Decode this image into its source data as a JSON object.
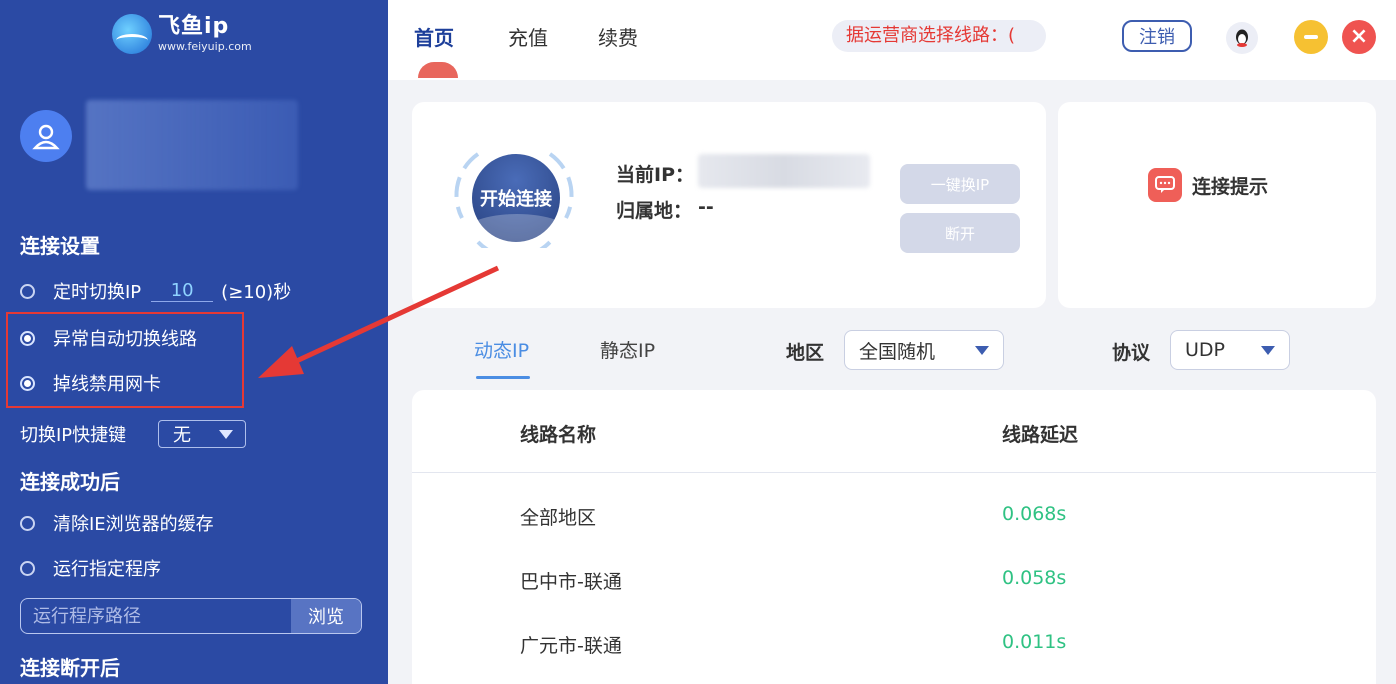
{
  "brand": {
    "name": "飞鱼ip",
    "url": "www.feiyuip.com"
  },
  "sidebar": {
    "conn_settings_title": "连接设置",
    "timer_label": "定时切换IP",
    "timer_value": "10",
    "timer_suffix": "(≥10)秒",
    "auto_switch_label": "异常自动切换线路",
    "disable_nic_label": "掉线禁用网卡",
    "hotkey_label": "切换IP快捷键",
    "hotkey_value": "无",
    "after_success_title": "连接成功后",
    "clear_cache_label": "清除IE浏览器的缓存",
    "run_program_label": "运行指定程序",
    "program_path_placeholder": "运行程序路径",
    "browse_label": "浏览",
    "after_disconnect_title": "连接断开后"
  },
  "topbar": {
    "tabs": [
      {
        "label": "首页"
      },
      {
        "label": "充值"
      },
      {
        "label": "续费"
      }
    ],
    "notice": "据运营商选择线路：(",
    "logout_label": "注销",
    "qq_icon": "qq-penguin-icon"
  },
  "connection": {
    "start_label": "开始连接",
    "current_ip_label": "当前IP：",
    "location_label": "归属地：",
    "location_value": "--",
    "switch_ip_label": "一键换IP",
    "disconnect_label": "断开",
    "tip_label": "连接提示"
  },
  "filters": {
    "tabs": [
      {
        "label": "动态IP"
      },
      {
        "label": "静态IP"
      }
    ],
    "region_label": "地区",
    "region_value": "全国随机",
    "protocol_label": "协议",
    "protocol_value": "UDP"
  },
  "table": {
    "headers": [
      "线路名称",
      "线路延迟"
    ],
    "rows": [
      {
        "name": "全部地区",
        "latency": "0.068s"
      },
      {
        "name": "巴中市-联通",
        "latency": "0.058s"
      },
      {
        "name": "广元市-联通",
        "latency": "0.011s"
      }
    ]
  },
  "colors": {
    "sidebar": "#2b4aa4",
    "accent": "#4b8de3",
    "latency": "#2fc283",
    "notice": "#e53935"
  }
}
